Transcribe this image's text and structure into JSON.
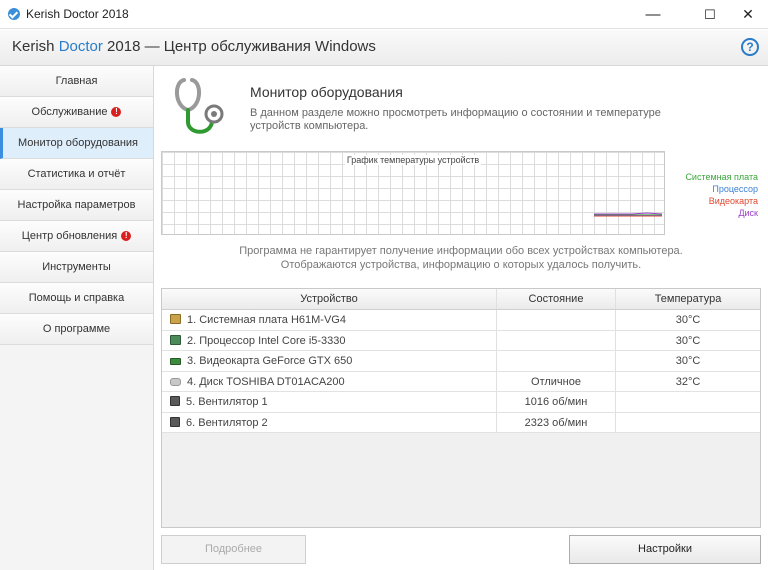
{
  "window": {
    "title": "Kerish Doctor 2018",
    "minimize": "—",
    "maximize": "☐",
    "close": "✕"
  },
  "header": {
    "brand_a": "Kerish ",
    "brand_b": "Doctor",
    "brand_c": " 2018 — Центр обслуживания Windows",
    "help": "?"
  },
  "sidebar": {
    "items": [
      {
        "label": "Главная"
      },
      {
        "label": "Обслуживание",
        "alert": "!"
      },
      {
        "label": "Монитор оборудования",
        "active": true
      },
      {
        "label": "Статистика и отчёт"
      },
      {
        "label": "Настройка параметров"
      },
      {
        "label": "Центр обновления",
        "alert": "!"
      },
      {
        "label": "Инструменты"
      },
      {
        "label": "Помощь и справка"
      },
      {
        "label": "О программе"
      }
    ]
  },
  "main": {
    "title": "Монитор оборудования",
    "description": "В данном разделе можно просмотреть информацию о состоянии и температуре устройств компьютера.",
    "graph_title": "График температуры устройств",
    "legend": [
      {
        "name": "Системная плата",
        "color": "#3aa73a"
      },
      {
        "name": "Процессор",
        "color": "#3b7fd4"
      },
      {
        "name": "Видеокарта",
        "color": "#e0462f"
      },
      {
        "name": "Диск",
        "color": "#9b3fc7"
      }
    ],
    "note_line1": "Программа не гарантирует получение информации обо всех устройствах компьютера.",
    "note_line2": "Отображаются устройства, информацию о которых удалось получить."
  },
  "table": {
    "headers": [
      "Устройство",
      "Состояние",
      "Температура"
    ],
    "rows": [
      {
        "device": "1. Системная плата H61M-VG4",
        "state": "",
        "temp": "30°C",
        "icon": "motherboard-icon"
      },
      {
        "device": "2. Процессор Intel Core i5-3330",
        "state": "",
        "temp": "30°C",
        "icon": "cpu-icon"
      },
      {
        "device": "3. Видеокарта GeForce GTX 650",
        "state": "",
        "temp": "30°C",
        "icon": "gpu-icon"
      },
      {
        "device": "4. Диск TOSHIBA DT01ACA200",
        "state": "Отличное",
        "temp": "32°C",
        "icon": "disk-icon"
      },
      {
        "device": "5. Вентилятор 1",
        "state": "1016 об/мин",
        "temp": "",
        "icon": "fan-icon"
      },
      {
        "device": "6. Вентилятор 2",
        "state": "2323 об/мин",
        "temp": "",
        "icon": "fan-icon"
      }
    ]
  },
  "buttons": {
    "details": "Подробнее",
    "settings": "Настройки"
  }
}
